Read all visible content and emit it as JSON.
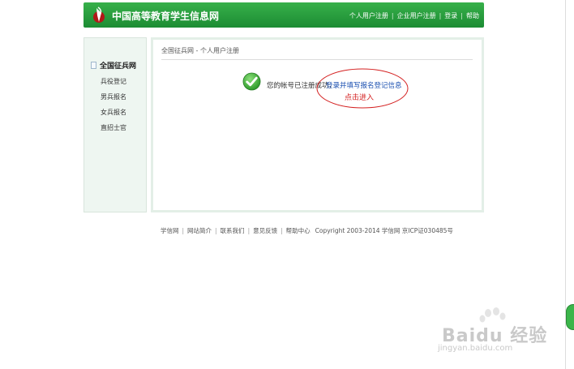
{
  "header": {
    "site_title": "中国高等教育学生信息网",
    "nav": [
      "个人用户注册",
      "企业用户注册",
      "登录",
      "帮助"
    ]
  },
  "sidebar": {
    "title": "全国征兵网",
    "items": [
      "兵役登记",
      "男兵报名",
      "女兵报名",
      "直招士官"
    ]
  },
  "main": {
    "breadcrumb": "全国征兵网 - 个人用户注册",
    "success_message": "您的帐号已注册成功，",
    "register_link": "登录并填写报名登记信息",
    "click_to_enter": "点击进入"
  },
  "footer": {
    "links": [
      "学信网",
      "网站简介",
      "联系我们",
      "意见反馈",
      "帮助中心"
    ],
    "copyright": "Copyright 2003-2014 学信网 京ICP证030485号"
  },
  "watermark": {
    "brand": "Baidu 经验",
    "url": "jingyan.baidu.com"
  },
  "colors": {
    "header_green": "#2a9e3e",
    "link_blue": "#1a4fb0",
    "annotation_red": "#d42020"
  }
}
